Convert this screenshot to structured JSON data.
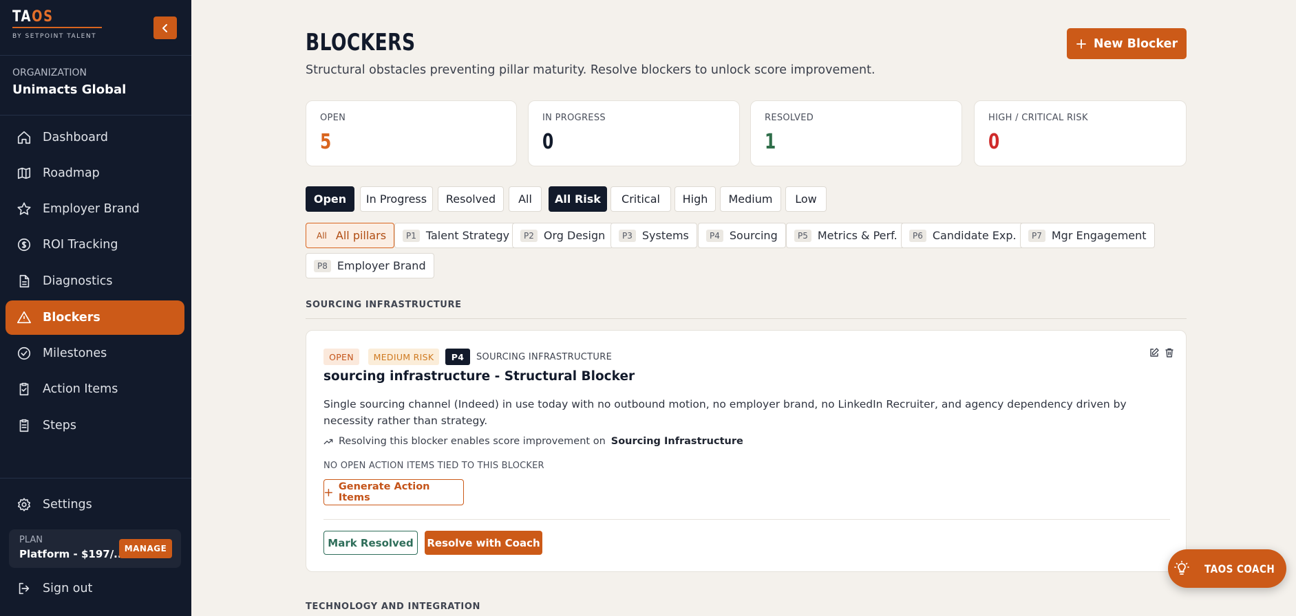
{
  "sidebar": {
    "logo_light": "TA",
    "logo_accent": "OS",
    "tagline": "BY SETPOINT TALENT",
    "org_label": "ORGANIZATION",
    "org_name": "Unimacts Global",
    "nav": [
      {
        "label": "Dashboard",
        "icon": "home-icon"
      },
      {
        "label": "Roadmap",
        "icon": "map-icon"
      },
      {
        "label": "Employer Brand",
        "icon": "star-icon"
      },
      {
        "label": "ROI Tracking",
        "icon": "dollar-circle-icon"
      },
      {
        "label": "Diagnostics",
        "icon": "document-icon"
      },
      {
        "label": "Blockers",
        "icon": "warning-triangle-icon"
      },
      {
        "label": "Milestones",
        "icon": "check-circle-icon"
      },
      {
        "label": "Action Items",
        "icon": "clipboard-check-icon"
      },
      {
        "label": "Steps",
        "icon": "clipboard-list-icon"
      }
    ],
    "active_nav": "Blockers",
    "settings_label": "Settings",
    "plan_label": "PLAN",
    "plan_value": "Platform - $197/...",
    "manage_label": "MANAGE",
    "signout_label": "Sign out"
  },
  "header": {
    "title": "BLOCKERS",
    "subtitle": "Structural obstacles preventing pillar maturity. Resolve blockers to unlock score improvement.",
    "new_button": "New Blocker"
  },
  "stats": [
    {
      "label": "OPEN",
      "value": "5",
      "color": "#d9651f"
    },
    {
      "label": "IN PROGRESS",
      "value": "0",
      "color": "#121a2b"
    },
    {
      "label": "RESOLVED",
      "value": "1",
      "color": "#2f6e4a"
    },
    {
      "label": "HIGH / CRITICAL RISK",
      "value": "0",
      "color": "#cf2a2a"
    }
  ],
  "status_filters": [
    "Open",
    "In Progress",
    "Resolved",
    "All"
  ],
  "active_status": "Open",
  "risk_filters": [
    "All Risk",
    "Critical",
    "High",
    "Medium",
    "Low"
  ],
  "active_risk": "All Risk",
  "pillar_filters": [
    {
      "code": "All",
      "label": "All pillars"
    },
    {
      "code": "P1",
      "label": "Talent Strategy"
    },
    {
      "code": "P2",
      "label": "Org Design"
    },
    {
      "code": "P3",
      "label": "Systems"
    },
    {
      "code": "P4",
      "label": "Sourcing"
    },
    {
      "code": "P5",
      "label": "Metrics & Perf."
    },
    {
      "code": "P6",
      "label": "Candidate Exp."
    },
    {
      "code": "P7",
      "label": "Mgr Engagement"
    },
    {
      "code": "P8",
      "label": "Employer Brand"
    }
  ],
  "active_pillar": "All",
  "sections": [
    {
      "label": "SOURCING INFRASTRUCTURE"
    },
    {
      "label": "TECHNOLOGY AND INTEGRATION"
    }
  ],
  "card": {
    "status_badge": "OPEN",
    "risk_badge": "MEDIUM RISK",
    "pillar_badge": "P4",
    "pillar_name": "SOURCING INFRASTRUCTURE",
    "title": "sourcing infrastructure - Structural Blocker",
    "description": "Single sourcing channel (Indeed) in use today with no outbound motion, no employer brand, no LinkedIn Recruiter, and agency dependency driven by necessity rather than strategy.",
    "note_prefix": "Resolving this blocker enables score improvement on",
    "note_target": "Sourcing Infrastructure",
    "no_items": "NO OPEN ACTION ITEMS TIED TO THIS BLOCKER",
    "generate_button": "Generate Action Items",
    "mark_resolved": "Mark Resolved",
    "resolve_coach": "Resolve with Coach"
  },
  "coach_fab": "TAOS COACH"
}
